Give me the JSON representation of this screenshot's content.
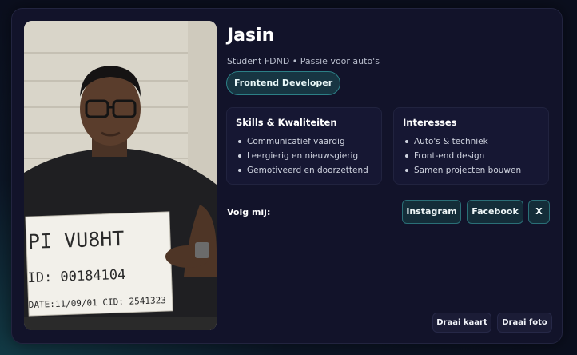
{
  "profile": {
    "name": "Jasin",
    "tagline": "Student FDND • Passie voor auto's",
    "role": "Frontend Developer",
    "photo_sign": {
      "line1": "PI VU8HT",
      "line2": "ID: 00184104",
      "line3": "DATE:11/09/01 CID: 2541323"
    }
  },
  "skills": {
    "title": "Skills & Kwaliteiten",
    "items": [
      "Communicatief vaardig",
      "Leergierig en nieuwsgierig",
      "Gemotiveerd en doorzettend"
    ]
  },
  "interests": {
    "title": "Interesses",
    "items": [
      "Auto's & techniek",
      "Front-end design",
      "Samen projecten bouwen"
    ]
  },
  "social": {
    "label": "Volg mij:",
    "links": [
      "Instagram",
      "Facebook",
      "X"
    ]
  },
  "actions": {
    "flip_card": "Draai kaart",
    "flip_photo": "Draai foto"
  },
  "colors": {
    "card_bg": "#12132a",
    "accent": "#2c7f86"
  }
}
